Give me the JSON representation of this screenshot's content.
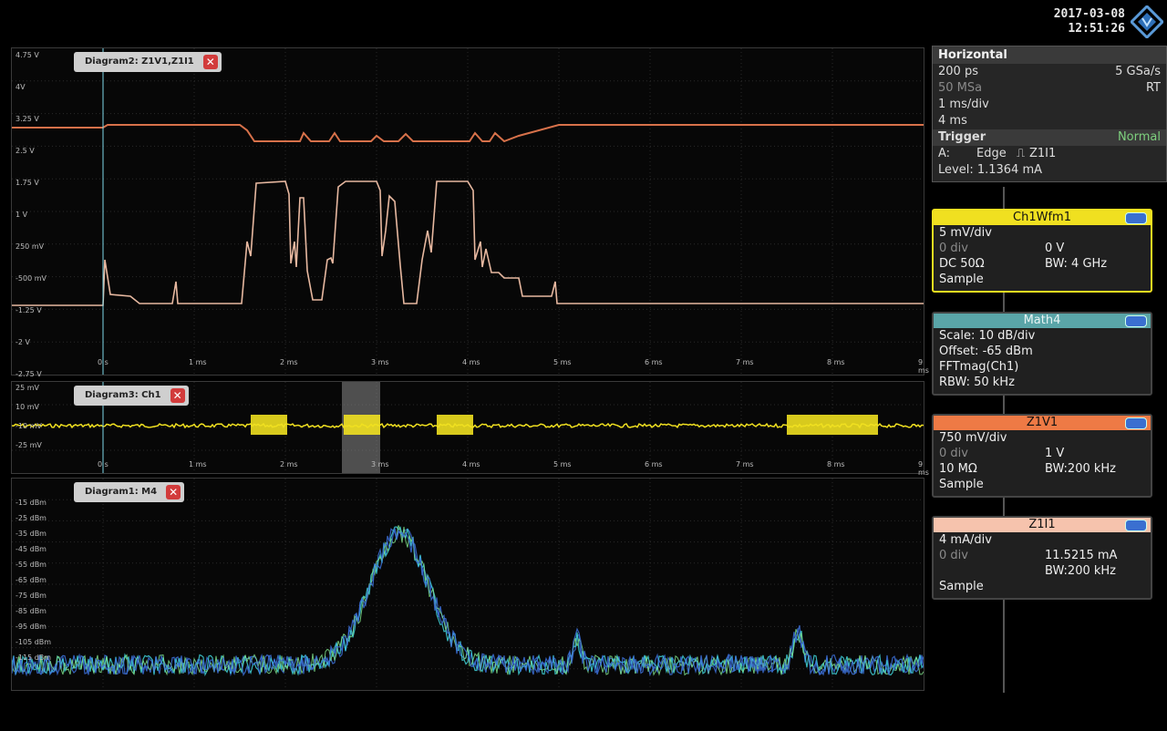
{
  "header": {
    "date": "2017-03-08",
    "time": "12:51:26"
  },
  "colors": {
    "z1v1": "#d7714a",
    "z1i1": "#e7b8a0",
    "ch1": "#f0e020",
    "math": "#5aa5a8",
    "fft_blue": "#3c70d8",
    "fft_cyan": "#3fd2d8",
    "fft_green": "#7ee08a"
  },
  "diagram2": {
    "tab": "Diagram2: Z1V1,Z1I1",
    "y_labels": [
      "4.75 V",
      "4V",
      "3.25 V",
      "2.5 V",
      "1.75 V",
      "1 V",
      "250 mV",
      "-500 mV",
      "-1.25 V",
      "-2 V",
      "-2.75 V"
    ],
    "x_labels": [
      "0 s",
      "1 ms",
      "2 ms",
      "3 ms",
      "4 ms",
      "5 ms",
      "6 ms",
      "7 ms",
      "8 ms",
      "9 ms"
    ]
  },
  "diagram3": {
    "tab": "Diagram3: Ch1",
    "y_labels": [
      "25 mV",
      "10 mV",
      "-10 mV",
      "-25 mV"
    ],
    "x_labels": [
      "0 s",
      "1 ms",
      "2 ms",
      "3 ms",
      "4 ms",
      "5 ms",
      "6 ms",
      "7 ms",
      "8 ms",
      "9 ms"
    ]
  },
  "diagram1": {
    "tab": "Diagram1: M4",
    "y_labels": [
      "-15 dBm",
      "-25 dBm",
      "-35 dBm",
      "-45 dBm",
      "-55 dBm",
      "-65 dBm",
      "-75 dBm",
      "-85 dBm",
      "-95 dBm",
      "-105 dBm",
      "-115 dBm"
    ]
  },
  "horizontal": {
    "title": "Horizontal",
    "resolution": "200 ps",
    "sample_rate": "5 GSa/s",
    "record_length": "50 MSa",
    "mode": "RT",
    "time_scale": "1 ms/div",
    "acq_time": "4 ms"
  },
  "trigger": {
    "title": "Trigger",
    "mode": "Normal",
    "source_prefix": "A:",
    "type": "Edge",
    "source": "Z1I1",
    "level": "Level: 1.1364 mA"
  },
  "ch1": {
    "title": "Ch1Wfm1",
    "scale": "5 mV/div",
    "offset_div": "0 div",
    "offset_value": "0 V",
    "coupling": "DC 50Ω",
    "bw": "BW: 4 GHz",
    "acq": "Sample"
  },
  "math4": {
    "title": "Math4",
    "scale": "Scale: 10 dB/div",
    "offset": "Offset: -65 dBm",
    "function": "FFTmag(Ch1)",
    "rbw": "RBW: 50 kHz"
  },
  "z1v1": {
    "title": "Z1V1",
    "scale": "750 mV/div",
    "offset_div": "0 div",
    "offset_value": "1 V",
    "impedance": "10 MΩ",
    "bw": "BW:200 kHz",
    "acq": "Sample"
  },
  "z1i1": {
    "title": "Z1I1",
    "scale": "4 mA/div",
    "offset_div": "0 div",
    "offset_value": "11.5215 mA",
    "bw": "BW:200 kHz",
    "acq": "Sample"
  }
}
